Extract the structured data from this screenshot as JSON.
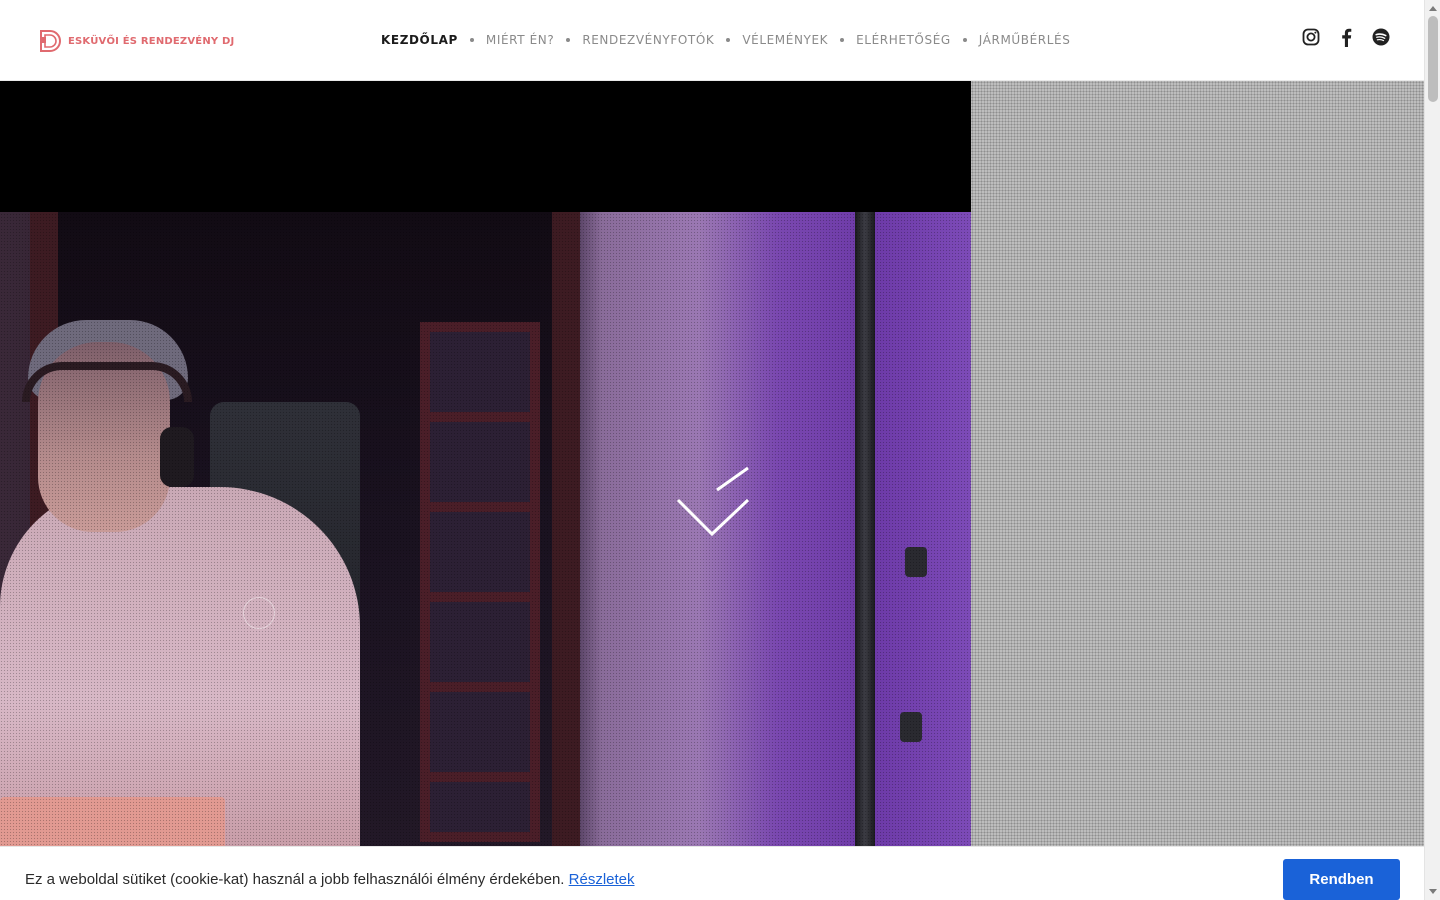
{
  "header": {
    "logo_text": "ESKÜVŐI ÉS RENDEZVÉNY DJ",
    "nav": [
      {
        "label": "KEZDŐLAP",
        "active": true
      },
      {
        "label": "MIÉRT ÉN?",
        "active": false
      },
      {
        "label": "RENDEZVÉNYFOTÓK",
        "active": false
      },
      {
        "label": "VÉLEMÉNYEK",
        "active": false
      },
      {
        "label": "ELÉRHETŐSÉG",
        "active": false
      },
      {
        "label": "JÁRMŰBÉRLÉS",
        "active": false
      }
    ],
    "socials": [
      "instagram-icon",
      "facebook-icon",
      "spotify-icon"
    ]
  },
  "hero": {
    "scroll_icon": "chevron-down-icon"
  },
  "cookie_bar": {
    "text": "Ez a weboldal sütiket (cookie-kat) használ a jobb felhasználói élmény érdekében.",
    "link": "Részletek",
    "button": "Rendben"
  },
  "colors": {
    "brand": "#e06a6f",
    "accent_button": "#1a62d8",
    "nav_active": "#1b1b1b",
    "nav_inactive": "#8a8a8a"
  }
}
